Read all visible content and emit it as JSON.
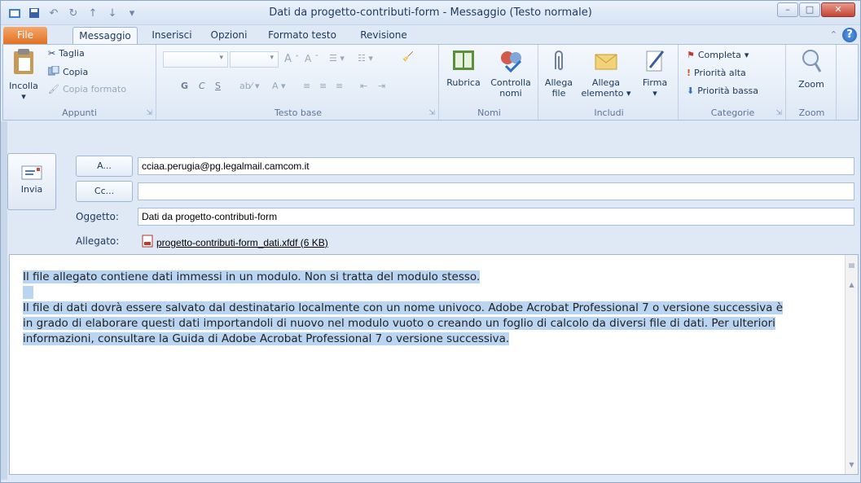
{
  "window": {
    "title": "Dati da progetto-contributi-form - Messaggio (Testo normale)"
  },
  "tabs": [
    "File",
    "Messaggio",
    "Inserisci",
    "Opzioni",
    "Formato testo",
    "Revisione"
  ],
  "ribbon": {
    "appunti": {
      "label": "Appunti",
      "paste": "Incolla",
      "cut": "Taglia",
      "copy": "Copia",
      "format_painter": "Copia formato"
    },
    "testo_base": {
      "label": "Testo base",
      "bold": "G",
      "italic": "C",
      "underline": "S"
    },
    "nomi": {
      "label": "Nomi",
      "rubrica": "Rubrica",
      "controlla_line1": "Controlla",
      "controlla_line2": "nomi"
    },
    "includi": {
      "label": "Includi",
      "allega_file_l1": "Allega",
      "allega_file_l2": "file",
      "allega_elem_l1": "Allega",
      "allega_elem_l2": "elemento",
      "firma": "Firma"
    },
    "categorie": {
      "label": "Categorie",
      "completa": "Completa",
      "priorita_alta": "Priorità alta",
      "priorita_bassa": "Priorità bassa"
    },
    "zoom": {
      "label": "Zoom",
      "button": "Zoom"
    }
  },
  "header": {
    "send": "Invia",
    "to_button": "A...",
    "cc_button": "Cc...",
    "to_value": "cciaa.perugia@pg.legalmail.camcom.it",
    "cc_value": "",
    "subject_label": "Oggetto:",
    "subject_value": "Dati da progetto-contributi-form",
    "attachment_label": "Allegato:",
    "attachment_name": "progetto-contributi-form_dati.xfdf (6 KB)"
  },
  "body": {
    "p1": "Il file allegato contiene dati immessi in un modulo. Non si tratta del modulo stesso.",
    "p2_l1": "Il file di dati dovrà essere salvato dal destinatario localmente con un nome univoco. Adobe Acrobat Professional 7 o versione successiva è",
    "p2_l2": "in grado di elaborare questi dati importandoli di nuovo nel modulo vuoto o creando un foglio di calcolo da diversi file di dati. Per ulteriori",
    "p2_l3": "informazioni, consultare la Guida di Adobe Acrobat Professional 7 o versione successiva."
  },
  "colors": {
    "file_tab": "#e06f21",
    "selection": "#b9d5f1",
    "close": "#c54434"
  }
}
